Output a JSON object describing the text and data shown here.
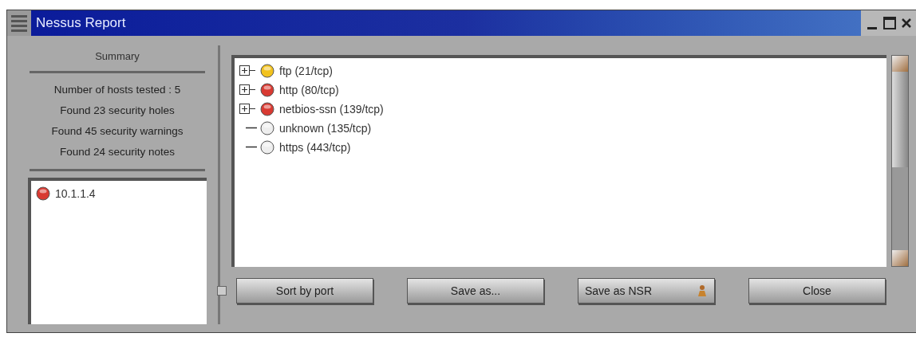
{
  "window": {
    "title": "Nessus Report"
  },
  "summary": {
    "title": "Summary",
    "lines": [
      "Number of hosts tested : 5",
      "Found 23 security holes",
      "Found 45 security warnings",
      "Found 24 security notes"
    ]
  },
  "hosts": [
    {
      "label": "10.1.1.4",
      "color": "#d83a32",
      "selected": false
    }
  ],
  "ports": [
    {
      "label": "ftp (21/tcp)",
      "kind": "expandable",
      "color": "#f2c21e"
    },
    {
      "label": "http (80/tcp)",
      "kind": "expandable",
      "color": "#d83a32"
    },
    {
      "label": "netbios-ssn (139/tcp)",
      "kind": "expandable",
      "color": "#d83a32"
    },
    {
      "label": "unknown (135/tcp)",
      "kind": "leaf",
      "color": "#eeeeee"
    },
    {
      "label": "https (443/tcp)",
      "kind": "leaf",
      "color": "#eeeeee"
    }
  ],
  "buttons": [
    {
      "label": "Sort by port",
      "kind": "plain"
    },
    {
      "label": "Save as...",
      "kind": "plain"
    },
    {
      "label": "Save as NSR",
      "kind": "icon"
    },
    {
      "label": "Close",
      "kind": "plain"
    }
  ]
}
